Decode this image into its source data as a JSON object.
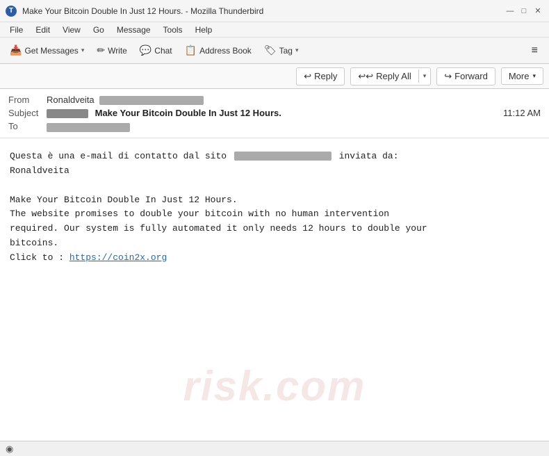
{
  "window": {
    "title": "Make Your Bitcoin Double In Just 12 Hours. - Mozilla Thunderbird",
    "app_icon": "T"
  },
  "titlebar": {
    "minimize": "—",
    "maximize": "□",
    "close": "✕"
  },
  "menubar": {
    "items": [
      "File",
      "Edit",
      "View",
      "Go",
      "Message",
      "Tools",
      "Help"
    ]
  },
  "toolbar": {
    "get_messages_label": "Get Messages",
    "write_label": "Write",
    "chat_label": "Chat",
    "address_book_label": "Address Book",
    "tag_label": "Tag",
    "menu_icon": "≡"
  },
  "action_bar": {
    "reply_label": "Reply",
    "reply_all_label": "Reply All",
    "forward_label": "Forward",
    "more_label": "More"
  },
  "email": {
    "from_label": "From",
    "from_name": "Ronaldveita",
    "subject_label": "Subject",
    "subject_text": "Make Your Bitcoin Double In Just 12 Hours.",
    "to_label": "To",
    "time": "11:12 AM",
    "body_line1a": "Questa è una e-mail di contatto dal sito",
    "body_line1b": "inviata da:",
    "body_line2": "Ronaldveita",
    "body_line3": "",
    "body_line4": "Make Your Bitcoin Double In Just 12 Hours.",
    "body_line5": "The website promises to double your bitcoin with no human intervention",
    "body_line6": "required. Our system is fully automated it only needs 12 hours to double your",
    "body_line7": "bitcoins.",
    "body_line8a": "Click to : ",
    "body_link": "https://coin2x.org"
  },
  "statusbar": {
    "icon": "◉",
    "text": ""
  },
  "watermark": {
    "text": "risk.com"
  },
  "icons": {
    "get_messages": "📥",
    "write": "✏",
    "chat": "💬",
    "address_book": "📋",
    "tag": "🏷",
    "reply": "↩",
    "reply_all": "↩↩",
    "forward": "↪"
  }
}
